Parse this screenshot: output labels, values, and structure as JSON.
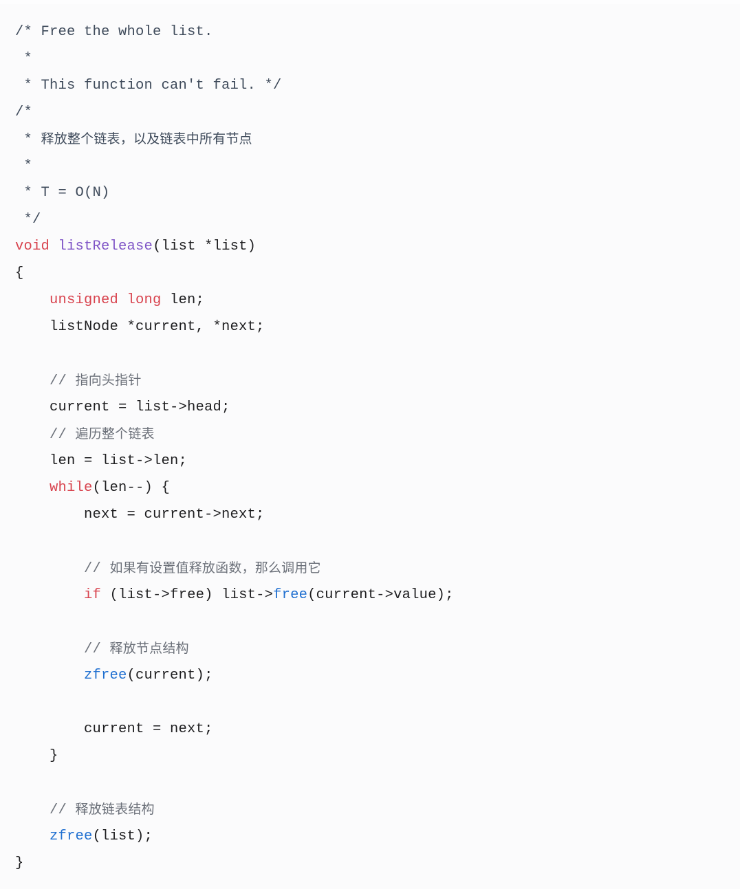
{
  "document": {
    "kind": "source-code-screenshot",
    "language": "C",
    "function_name": "listRelease",
    "background_color": "#fbfbfc"
  },
  "theme": {
    "plain": "#1d1d1f",
    "block_comment": "#3f4b5b",
    "line_comment": "#6b7079",
    "keyword": "#d8434e",
    "function_def": "#7e53c6",
    "function_call": "#1f6fd0"
  },
  "code": {
    "lines": [
      {
        "id": "line-01",
        "tokens": [
          {
            "text": "/* Free the whole list.",
            "type": "blockcomment"
          }
        ]
      },
      {
        "id": "line-02",
        "tokens": [
          {
            "text": " *",
            "type": "blockcomment"
          }
        ]
      },
      {
        "id": "line-03",
        "tokens": [
          {
            "text": " * This function can't fail. */",
            "type": "blockcomment"
          }
        ]
      },
      {
        "id": "line-04",
        "tokens": [
          {
            "text": "/*",
            "type": "blockcomment"
          }
        ]
      },
      {
        "id": "line-05",
        "tokens": [
          {
            "text": " * ",
            "type": "blockcomment"
          },
          {
            "text": "释放整个链表，以及链表中所有节点",
            "type": "blockcomment",
            "cjk": true
          }
        ]
      },
      {
        "id": "line-06",
        "tokens": [
          {
            "text": " *",
            "type": "blockcomment"
          }
        ]
      },
      {
        "id": "line-07",
        "tokens": [
          {
            "text": " * T = O(N)",
            "type": "blockcomment"
          }
        ]
      },
      {
        "id": "line-08",
        "tokens": [
          {
            "text": " */",
            "type": "blockcomment"
          }
        ]
      },
      {
        "id": "line-09",
        "tokens": [
          {
            "text": "void",
            "type": "keyword"
          },
          {
            "text": " ",
            "type": "plain"
          },
          {
            "text": "listRelease",
            "type": "function"
          },
          {
            "text": "(list *list)",
            "type": "plain"
          }
        ]
      },
      {
        "id": "line-10",
        "tokens": [
          {
            "text": "{",
            "type": "plain"
          }
        ]
      },
      {
        "id": "line-11",
        "tokens": [
          {
            "text": "    ",
            "type": "plain"
          },
          {
            "text": "unsigned long",
            "type": "keyword"
          },
          {
            "text": " len;",
            "type": "plain"
          }
        ]
      },
      {
        "id": "line-12",
        "tokens": [
          {
            "text": "    listNode *current, *next;",
            "type": "plain"
          }
        ]
      },
      {
        "id": "line-13",
        "tokens": [
          {
            "text": "",
            "type": "blank"
          }
        ]
      },
      {
        "id": "line-14",
        "tokens": [
          {
            "text": "    // ",
            "type": "linecomment"
          },
          {
            "text": "指向头指针",
            "type": "linecomment",
            "cjk": true
          }
        ]
      },
      {
        "id": "line-15",
        "tokens": [
          {
            "text": "    current = list->head;",
            "type": "plain"
          }
        ]
      },
      {
        "id": "line-16",
        "tokens": [
          {
            "text": "    // ",
            "type": "linecomment"
          },
          {
            "text": "遍历整个链表",
            "type": "linecomment",
            "cjk": true
          }
        ]
      },
      {
        "id": "line-17",
        "tokens": [
          {
            "text": "    len = list->len;",
            "type": "plain"
          }
        ]
      },
      {
        "id": "line-18",
        "tokens": [
          {
            "text": "    ",
            "type": "plain"
          },
          {
            "text": "while",
            "type": "keyword"
          },
          {
            "text": "(len--) {",
            "type": "plain"
          }
        ]
      },
      {
        "id": "line-19",
        "tokens": [
          {
            "text": "        next = current->next;",
            "type": "plain"
          }
        ]
      },
      {
        "id": "line-20",
        "tokens": [
          {
            "text": "",
            "type": "blank"
          }
        ]
      },
      {
        "id": "line-21",
        "tokens": [
          {
            "text": "        // ",
            "type": "linecomment"
          },
          {
            "text": "如果有设置值释放函数，那么调用它",
            "type": "linecomment",
            "cjk": true
          }
        ]
      },
      {
        "id": "line-22",
        "tokens": [
          {
            "text": "        ",
            "type": "plain"
          },
          {
            "text": "if",
            "type": "keyword"
          },
          {
            "text": " (list->free) list->",
            "type": "plain"
          },
          {
            "text": "free",
            "type": "call"
          },
          {
            "text": "(current->value);",
            "type": "plain"
          }
        ]
      },
      {
        "id": "line-23",
        "tokens": [
          {
            "text": "",
            "type": "blank"
          }
        ]
      },
      {
        "id": "line-24",
        "tokens": [
          {
            "text": "        // ",
            "type": "linecomment"
          },
          {
            "text": "释放节点结构",
            "type": "linecomment",
            "cjk": true
          }
        ]
      },
      {
        "id": "line-25",
        "tokens": [
          {
            "text": "        ",
            "type": "plain"
          },
          {
            "text": "zfree",
            "type": "call"
          },
          {
            "text": "(current);",
            "type": "plain"
          }
        ]
      },
      {
        "id": "line-26",
        "tokens": [
          {
            "text": "",
            "type": "blank"
          }
        ]
      },
      {
        "id": "line-27",
        "tokens": [
          {
            "text": "        current = next;",
            "type": "plain"
          }
        ]
      },
      {
        "id": "line-28",
        "tokens": [
          {
            "text": "    }",
            "type": "plain"
          }
        ]
      },
      {
        "id": "line-29",
        "tokens": [
          {
            "text": "",
            "type": "blank"
          }
        ]
      },
      {
        "id": "line-30",
        "tokens": [
          {
            "text": "    // ",
            "type": "linecomment"
          },
          {
            "text": "释放链表结构",
            "type": "linecomment",
            "cjk": true
          }
        ]
      },
      {
        "id": "line-31",
        "tokens": [
          {
            "text": "    ",
            "type": "plain"
          },
          {
            "text": "zfree",
            "type": "call"
          },
          {
            "text": "(list);",
            "type": "plain"
          }
        ]
      },
      {
        "id": "line-32",
        "tokens": [
          {
            "text": "}",
            "type": "plain"
          }
        ]
      }
    ]
  }
}
